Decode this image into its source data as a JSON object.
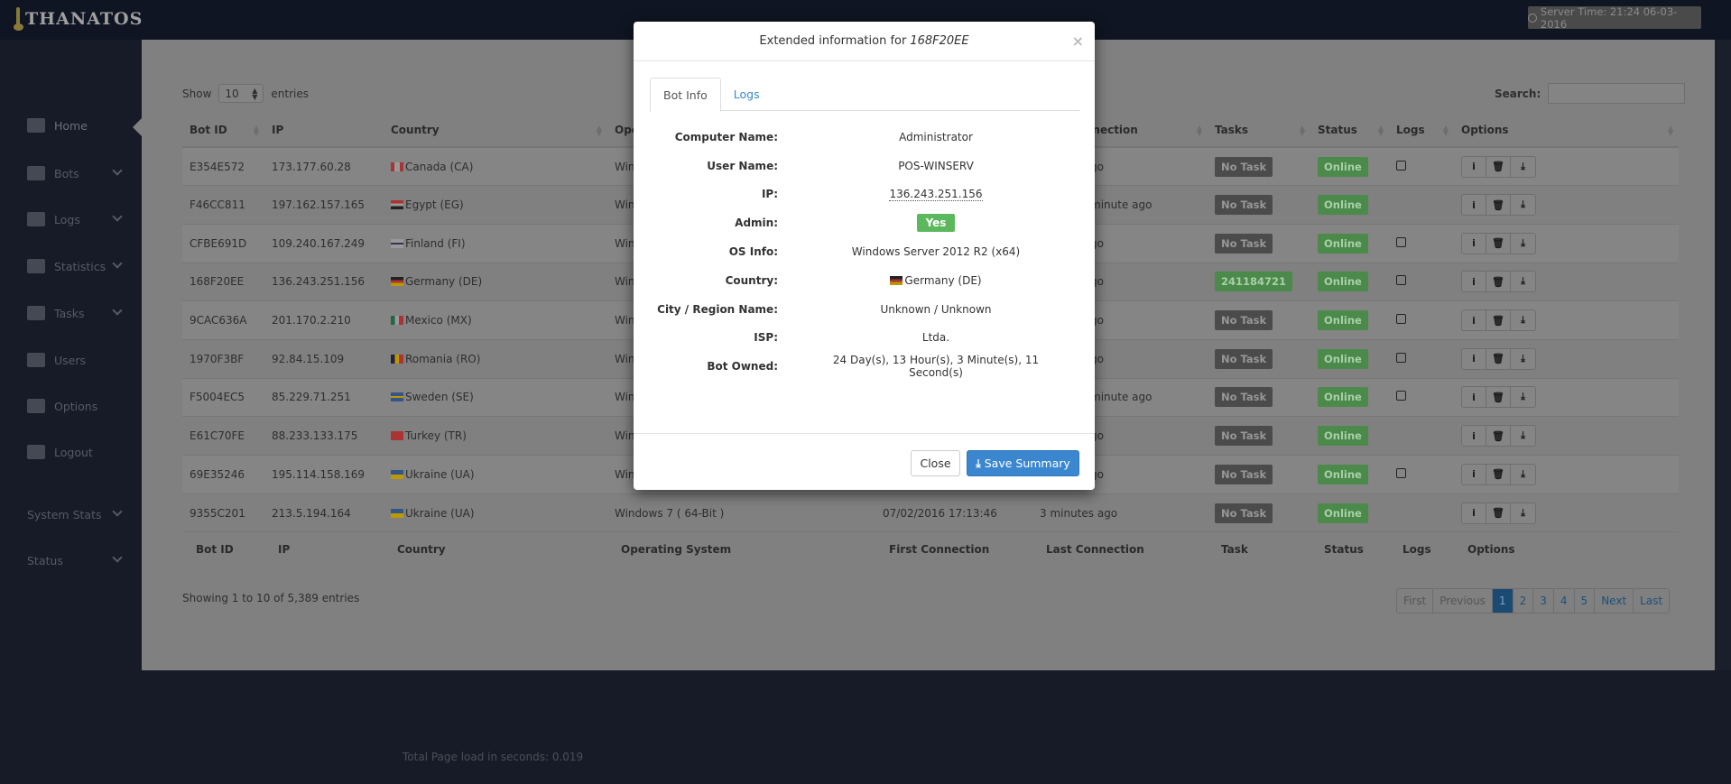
{
  "app": {
    "logo_text": "THANATOS",
    "server_time": "Server Time: 21:24 06-03-2016"
  },
  "sidebar": {
    "items": [
      {
        "label": "Home",
        "icon": "home-icon",
        "chevron": false,
        "active": true
      },
      {
        "label": "Bots",
        "icon": "users-icon",
        "chevron": true,
        "active": false
      },
      {
        "label": "Logs",
        "icon": "file-icon",
        "chevron": true,
        "active": false
      },
      {
        "label": "Statistics",
        "icon": "bar-chart-icon",
        "chevron": true,
        "active": false
      },
      {
        "label": "Tasks",
        "icon": "tasks-icon",
        "chevron": true,
        "active": false
      },
      {
        "label": "Users",
        "icon": "sitemap-icon",
        "chevron": false,
        "active": false
      },
      {
        "label": "Options",
        "icon": "gear-icon",
        "chevron": false,
        "active": false
      },
      {
        "label": "Logout",
        "icon": "share-icon",
        "chevron": false,
        "active": false
      },
      {
        "label": "System Stats",
        "icon": "",
        "chevron": true,
        "active": false
      },
      {
        "label": "Status",
        "icon": "",
        "chevron": true,
        "active": false
      }
    ]
  },
  "table": {
    "show_label": "Show",
    "entries_label": "entries",
    "page_size": "10",
    "search_label": "Search:",
    "search_value": "",
    "columns": [
      "Bot ID",
      "IP",
      "Country",
      "Operating System",
      "First Connection",
      "Last Connection",
      "Tasks",
      "Status",
      "Logs",
      "Options"
    ],
    "footer_columns": [
      "Bot ID",
      "IP",
      "Country",
      "Operating System",
      "First Connection",
      "Last Connection",
      "Task",
      "Status",
      "Logs",
      "Options"
    ],
    "rows": [
      {
        "id": "E354E572",
        "ip": "173.177.60.28",
        "flag": "ca",
        "country": "Canada (CA)",
        "os": "Win",
        "first": "",
        "last": "go",
        "task": "No Task",
        "status": "Online",
        "logs": true
      },
      {
        "id": "F46CC811",
        "ip": "197.162.157.165",
        "flag": "eg",
        "country": "Egypt (EG)",
        "os": "Win",
        "first": "",
        "last": "minute ago",
        "task": "No Task",
        "status": "Online",
        "logs": false
      },
      {
        "id": "CFBE691D",
        "ip": "109.240.167.249",
        "flag": "fi",
        "country": "Finland (FI)",
        "os": "Win",
        "first": "",
        "last": "go",
        "task": "No Task",
        "status": "Online",
        "logs": true
      },
      {
        "id": "168F20EE",
        "ip": "136.243.251.156",
        "flag": "de",
        "country": "Germany (DE)",
        "os": "Win",
        "first": "",
        "last": "go",
        "task": "241184721",
        "status": "Online",
        "logs": true
      },
      {
        "id": "9CAC636A",
        "ip": "201.170.2.210",
        "flag": "mx",
        "country": "Mexico (MX)",
        "os": "Win",
        "first": "",
        "last": "go",
        "task": "No Task",
        "status": "Online",
        "logs": true
      },
      {
        "id": "1970F3BF",
        "ip": "92.84.15.109",
        "flag": "ro",
        "country": "Romania (RO)",
        "os": "Win",
        "first": "",
        "last": "go",
        "task": "No Task",
        "status": "Online",
        "logs": true
      },
      {
        "id": "F5004EC5",
        "ip": "85.229.71.251",
        "flag": "se",
        "country": "Sweden (SE)",
        "os": "Win",
        "first": "",
        "last": "minute ago",
        "task": "No Task",
        "status": "Online",
        "logs": true
      },
      {
        "id": "E61C70FE",
        "ip": "88.233.133.175",
        "flag": "tr",
        "country": "Turkey (TR)",
        "os": "Win",
        "first": "",
        "last": "go",
        "task": "No Task",
        "status": "Online",
        "logs": false
      },
      {
        "id": "69E35246",
        "ip": "195.114.158.169",
        "flag": "ua",
        "country": "Ukraine (UA)",
        "os": "Win",
        "first": "",
        "last": "go",
        "task": "No Task",
        "status": "Online",
        "logs": true
      },
      {
        "id": "9355C201",
        "ip": "213.5.194.164",
        "flag": "ua",
        "country": "Ukraine (UA)",
        "os": "Windows 7 ( 64-Bit )",
        "first": "07/02/2016 17:13:46",
        "last": "3 minutes ago",
        "task": "No Task",
        "status": "Online",
        "logs": false
      }
    ],
    "showing": "Showing 1 to 10 of 5,389 entries",
    "pagination": [
      "First",
      "Previous",
      "1",
      "2",
      "3",
      "4",
      "5",
      "Next",
      "Last"
    ],
    "current_page": "1"
  },
  "footer": {
    "load_time": "Total Page load in seconds: 0.019"
  },
  "modal": {
    "title_prefix": "Extended information for",
    "title_id": "168F20EE",
    "close_x": "×",
    "tabs": [
      "Bot Info",
      "Logs"
    ],
    "active_tab": "Bot Info",
    "fields": [
      {
        "label": "Computer Name:",
        "value": "Administrator"
      },
      {
        "label": "User Name:",
        "value": "POS-WINSERV"
      },
      {
        "label": "IP:",
        "value": "136.243.251.156"
      },
      {
        "label": "Admin:",
        "value": "Yes"
      },
      {
        "label": "OS Info:",
        "value": "Windows Server 2012 R2 (x64)"
      },
      {
        "label": "Country:",
        "value": "Germany (DE)",
        "flag": "de"
      },
      {
        "label": "City / Region Name:",
        "value": "Unknown / Unknown"
      },
      {
        "label": "ISP:",
        "value": "Ltda."
      },
      {
        "label": "Bot Owned:",
        "value": "24 Day(s), 13 Hour(s), 3 Minute(s), 11 Second(s)"
      }
    ],
    "close_label": "Close",
    "save_label": "Save Summary"
  },
  "colors": {
    "online": "#5cb85c",
    "primary": "#428bca",
    "no_task": "#777777"
  }
}
